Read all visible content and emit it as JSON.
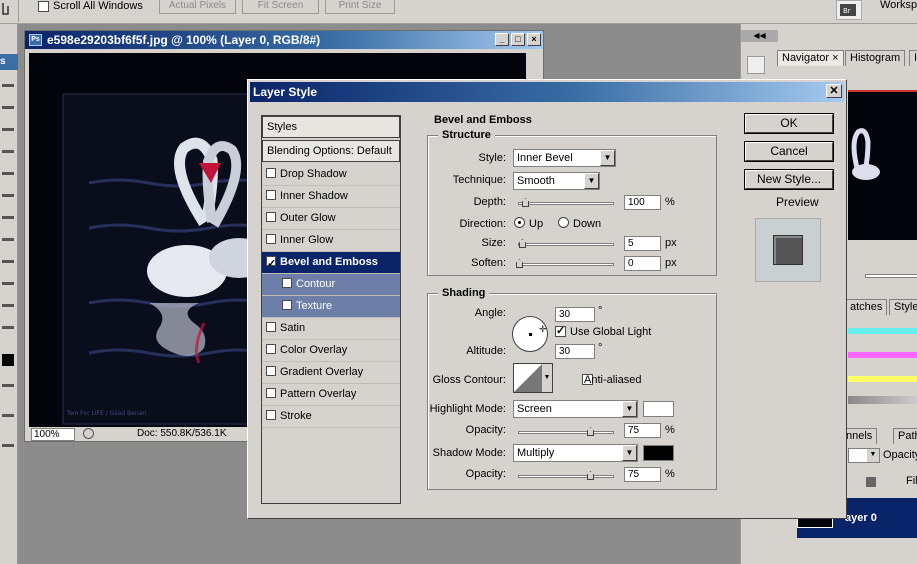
{
  "options_bar": {
    "scroll_all_label": "Scroll All Windows",
    "buttons": [
      "Actual Pixels",
      "Fit Screen",
      "Print Size"
    ],
    "workspace_label": "Worksp"
  },
  "document": {
    "title": "e598e29203bf6f5f.jpg @ 100% (Layer 0, RGB/8#)",
    "watermark": "Two For LIFE / Gilad Benari",
    "zoom": "100%",
    "doc_size": "Doc: 550.8K/536.1K"
  },
  "right_panel": {
    "tabs_top": [
      "Navigator",
      "Histogram",
      "I"
    ],
    "tabs_mid": [
      "atches",
      "Style"
    ],
    "tabs_low": [
      "nnels",
      "Path"
    ],
    "opacity_label": "Opacity",
    "fill_label": "Fil",
    "layer_name": "ayer 0",
    "colors": {
      "highlight_row": "#0a246a"
    }
  },
  "dialog": {
    "title": "Layer Style",
    "styles_header": "Styles",
    "blending_options": "Blending Options: Default",
    "style_items": [
      {
        "label": "Drop Shadow",
        "checked": false
      },
      {
        "label": "Inner Shadow",
        "checked": false
      },
      {
        "label": "Outer Glow",
        "checked": false
      },
      {
        "label": "Inner Glow",
        "checked": false
      },
      {
        "label": "Bevel and Emboss",
        "checked": true
      },
      {
        "label": "Contour",
        "checked": false
      },
      {
        "label": "Texture",
        "checked": false
      },
      {
        "label": "Satin",
        "checked": false
      },
      {
        "label": "Color Overlay",
        "checked": false
      },
      {
        "label": "Gradient Overlay",
        "checked": false
      },
      {
        "label": "Pattern Overlay",
        "checked": false
      },
      {
        "label": "Stroke",
        "checked": false
      }
    ],
    "section_title": "Bevel and Emboss",
    "structure": {
      "title": "Structure",
      "style_label": "Style:",
      "style_value": "Inner Bevel",
      "technique_label": "Technique:",
      "technique_value": "Smooth",
      "depth_label": "Depth:",
      "depth_value": "100",
      "depth_unit": "%",
      "direction_label": "Direction:",
      "direction_up": "Up",
      "direction_down": "Down",
      "size_label": "Size:",
      "size_value": "5",
      "size_unit": "px",
      "soften_label": "Soften:",
      "soften_value": "0",
      "soften_unit": "px"
    },
    "shading": {
      "title": "Shading",
      "angle_label": "Angle:",
      "angle_value": "30",
      "degree": "°",
      "global_light_label": "Use Global Light",
      "altitude_label": "Altitude:",
      "altitude_value": "30",
      "gloss_label": "Gloss Contour:",
      "anti_aliased_label": "Anti-aliased",
      "highlight_mode_label": "Highlight Mode:",
      "highlight_mode_value": "Screen",
      "highlight_opacity_label": "Opacity:",
      "highlight_opacity_value": "75",
      "shadow_mode_label": "Shadow Mode:",
      "shadow_mode_value": "Multiply",
      "shadow_opacity_label": "Opacity:",
      "shadow_opacity_value": "75",
      "opacity_unit": "%",
      "highlight_color": "#ffffff",
      "shadow_color": "#000000"
    },
    "buttons": {
      "ok": "OK",
      "cancel": "Cancel",
      "new_style": "New Style...",
      "preview": "Preview"
    }
  }
}
